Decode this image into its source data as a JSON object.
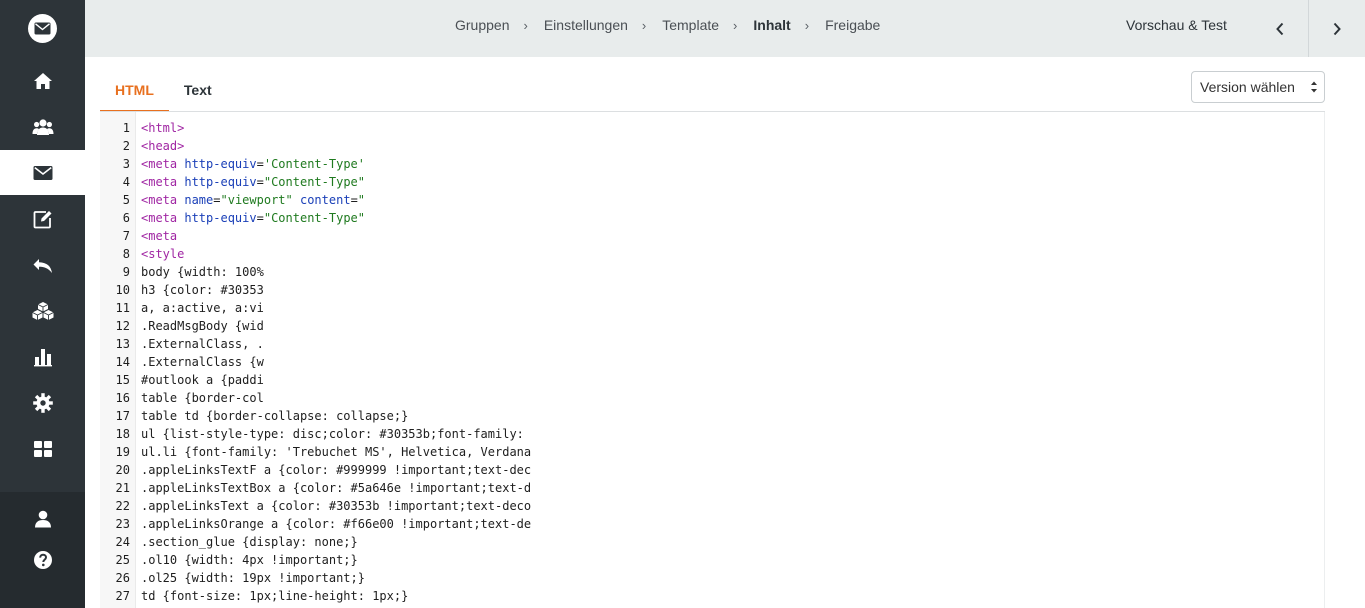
{
  "breadcrumb": [
    {
      "label": "Gruppen",
      "current": false
    },
    {
      "label": "Einstellungen",
      "current": false
    },
    {
      "label": "Template",
      "current": false
    },
    {
      "label": "Inhalt",
      "current": true
    },
    {
      "label": "Freigabe",
      "current": false
    }
  ],
  "topbar": {
    "preview_label": "Vorschau & Test",
    "prev_icon": "chevron-left-icon",
    "next_icon": "chevron-right-icon"
  },
  "sidebar": {
    "logo_icon": "envelope-icon",
    "items": [
      {
        "icon": "home-icon",
        "active": false
      },
      {
        "icon": "users-icon",
        "active": false
      },
      {
        "icon": "envelope-icon",
        "active": true
      },
      {
        "icon": "edit-icon",
        "active": false
      },
      {
        "icon": "reply-icon",
        "active": false
      },
      {
        "icon": "cubes-icon",
        "active": false
      },
      {
        "icon": "bar-chart-icon",
        "active": false
      },
      {
        "icon": "gear-icon",
        "active": false
      },
      {
        "icon": "grid-icon",
        "active": false
      }
    ],
    "bottom_items": [
      {
        "icon": "user-icon"
      },
      {
        "icon": "help-icon"
      }
    ]
  },
  "tabs": [
    {
      "label": "HTML",
      "active": true
    },
    {
      "label": "Text",
      "active": false
    }
  ],
  "version_select": {
    "selected": "Version wählen"
  },
  "editor": {
    "lines": [
      {
        "n": "1",
        "parts": [
          {
            "t": "tag",
            "v": "<html>"
          }
        ]
      },
      {
        "n": "2",
        "parts": [
          {
            "t": "tag",
            "v": "<head>"
          }
        ]
      },
      {
        "n": "3",
        "parts": [
          {
            "t": "tag",
            "v": "<meta "
          },
          {
            "t": "attr",
            "v": "http-equiv"
          },
          {
            "t": "plain",
            "v": "="
          },
          {
            "t": "str",
            "v": "'Content-Type'"
          }
        ]
      },
      {
        "n": "4",
        "parts": [
          {
            "t": "tag",
            "v": "<meta "
          },
          {
            "t": "attr",
            "v": "http-equiv"
          },
          {
            "t": "plain",
            "v": "="
          },
          {
            "t": "str",
            "v": "\"Content-Type\""
          }
        ]
      },
      {
        "n": "5",
        "parts": [
          {
            "t": "tag",
            "v": "<meta "
          },
          {
            "t": "attr",
            "v": "name"
          },
          {
            "t": "plain",
            "v": "="
          },
          {
            "t": "str",
            "v": "\"viewport\""
          },
          {
            "t": "plain",
            "v": " "
          },
          {
            "t": "attr",
            "v": "content"
          },
          {
            "t": "plain",
            "v": "="
          },
          {
            "t": "str",
            "v": "\""
          }
        ]
      },
      {
        "n": "6",
        "parts": [
          {
            "t": "tag",
            "v": "<meta "
          },
          {
            "t": "attr",
            "v": "http-equiv"
          },
          {
            "t": "plain",
            "v": "="
          },
          {
            "t": "str",
            "v": "\"Content-Type\""
          }
        ]
      },
      {
        "n": "7",
        "parts": [
          {
            "t": "tag",
            "v": "<meta"
          }
        ]
      },
      {
        "n": "8",
        "parts": [
          {
            "t": "tag",
            "v": "<style"
          }
        ]
      },
      {
        "n": "9",
        "parts": [
          {
            "t": "plain",
            "v": "body {width: 100%"
          }
        ]
      },
      {
        "n": "10",
        "parts": [
          {
            "t": "plain",
            "v": "h3 {color: #30353"
          }
        ]
      },
      {
        "n": "11",
        "parts": [
          {
            "t": "plain",
            "v": "a, a:active, a:vi"
          }
        ]
      },
      {
        "n": "12",
        "parts": [
          {
            "t": "plain",
            "v": ".ReadMsgBody {wid"
          }
        ]
      },
      {
        "n": "13",
        "parts": [
          {
            "t": "plain",
            "v": ".ExternalClass, ."
          }
        ]
      },
      {
        "n": "14",
        "parts": [
          {
            "t": "plain",
            "v": ".ExternalClass {w"
          }
        ]
      },
      {
        "n": "15",
        "parts": [
          {
            "t": "plain",
            "v": "#outlook a {paddi"
          }
        ]
      },
      {
        "n": "16",
        "parts": [
          {
            "t": "plain",
            "v": "table {border-col"
          }
        ]
      },
      {
        "n": "17",
        "parts": [
          {
            "t": "plain",
            "v": "table td {border-collapse: collapse;}"
          }
        ]
      },
      {
        "n": "18",
        "parts": [
          {
            "t": "plain",
            "v": "ul {list-style-type: disc;color: #30353b;font-family:"
          }
        ]
      },
      {
        "n": "19",
        "parts": [
          {
            "t": "plain",
            "v": "ul.li {font-family: 'Trebuchet MS', Helvetica, Verdana"
          }
        ]
      },
      {
        "n": "20",
        "parts": [
          {
            "t": "plain",
            "v": ".appleLinksTextF a {color: #999999 !important;text-dec"
          }
        ]
      },
      {
        "n": "21",
        "parts": [
          {
            "t": "plain",
            "v": ".appleLinksTextBox a {color: #5a646e !important;text-d"
          }
        ]
      },
      {
        "n": "22",
        "parts": [
          {
            "t": "plain",
            "v": ".appleLinksText a {color: #30353b !important;text-deco"
          }
        ]
      },
      {
        "n": "23",
        "parts": [
          {
            "t": "plain",
            "v": ".appleLinksOrange a {color: #f66e00 !important;text-de"
          }
        ]
      },
      {
        "n": "24",
        "parts": [
          {
            "t": "plain",
            "v": ".section_glue {display: none;}"
          }
        ]
      },
      {
        "n": "25",
        "parts": [
          {
            "t": "plain",
            "v": ".ol10 {width: 4px !important;}"
          }
        ]
      },
      {
        "n": "26",
        "parts": [
          {
            "t": "plain",
            "v": ".ol25 {width: 19px !important;}"
          }
        ]
      },
      {
        "n": "27",
        "parts": [
          {
            "t": "plain",
            "v": "td {font-size: 1px;line-height: 1px;}"
          }
        ]
      }
    ]
  },
  "colors": {
    "sidebar_bg": "#2d3439",
    "topbar_bg": "#e8ecec",
    "accent": "#e8701f",
    "tag": "#a026a3",
    "attr": "#1b40b8",
    "string": "#1f7a1f"
  }
}
